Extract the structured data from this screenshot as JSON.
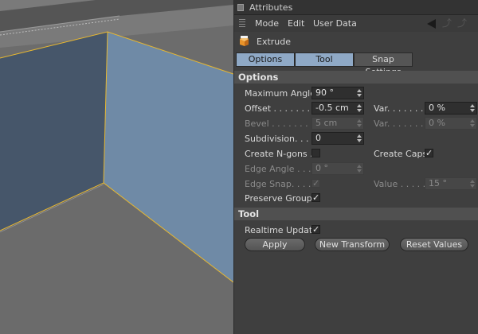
{
  "panel": {
    "title": "Attributes",
    "menu": [
      "Mode",
      "Edit",
      "User Data"
    ],
    "object_name": "Extrude",
    "tabs": [
      {
        "label": "Options",
        "active": true
      },
      {
        "label": "Tool",
        "active": true
      },
      {
        "label": "Snap Settings",
        "active": false
      }
    ]
  },
  "options": {
    "section_title": "Options",
    "max_angle": {
      "label": "Maximum Angle",
      "value": "90 °"
    },
    "offset": {
      "label": "Offset . . . . . . . .",
      "value": "-0.5 cm"
    },
    "var1": {
      "label": "Var. . . . . . .",
      "value": "0 %"
    },
    "bevel": {
      "label": "Bevel . . . . . . . .",
      "value": "5 cm"
    },
    "var2": {
      "label": "Var. . . . . . .",
      "value": "0 %"
    },
    "subdivision": {
      "label": "Subdivision. . . .",
      "value": "0"
    },
    "create_ngons": {
      "label": "Create N-gons .",
      "checked": false
    },
    "create_caps": {
      "label": "Create Caps",
      "checked": true
    },
    "edge_angle": {
      "label": "Edge Angle . . .",
      "value": "0 °"
    },
    "edge_snap": {
      "label": "Edge Snap. . . .",
      "checked": true
    },
    "value": {
      "label": "Value . . . . .",
      "value": "15 °"
    },
    "preserve_groups": {
      "label": "Preserve Groups",
      "checked": true
    }
  },
  "tool": {
    "section_title": "Tool",
    "realtime_update": {
      "label": "Realtime Update",
      "checked": true
    },
    "apply_label": "Apply",
    "new_transform_label": "New Transform",
    "reset_values_label": "Reset Values"
  },
  "icons": {
    "checkmark": "✓",
    "nav_up": "⤴"
  },
  "colors": {
    "panel_bg": "#3f3f3f",
    "tab_active": "#8fa9c6",
    "selection_edge": "#e8b830",
    "face_selected": "#6f8aa6",
    "face_dark": "#46566a"
  }
}
